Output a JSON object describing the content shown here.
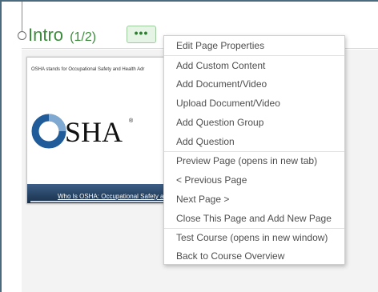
{
  "section": {
    "title": "Intro",
    "count": "(1/2)",
    "menu_button_icon": "ellipsis-icon"
  },
  "preview": {
    "caption": "OSHA stands for Occupational Safety and Health Adr",
    "logo_text": "OSHA",
    "video_title": "Who Is OSHA: Occupational Safety a"
  },
  "menu": {
    "items": [
      "Edit Page Properties",
      "Add Custom Content",
      "Add Document/Video",
      "Upload Document/Video",
      "Add Question Group",
      "Add Question",
      "Preview Page (opens in new tab)",
      "< Previous Page",
      "Next Page >",
      "Close This Page and Add New Page",
      "Test Course (opens in new window)",
      "Back to Course Overview"
    ]
  },
  "colors": {
    "accent_green": "#3d8b3d",
    "frame_border": "#4a6a80",
    "osha_blue": "#1f5c99"
  }
}
